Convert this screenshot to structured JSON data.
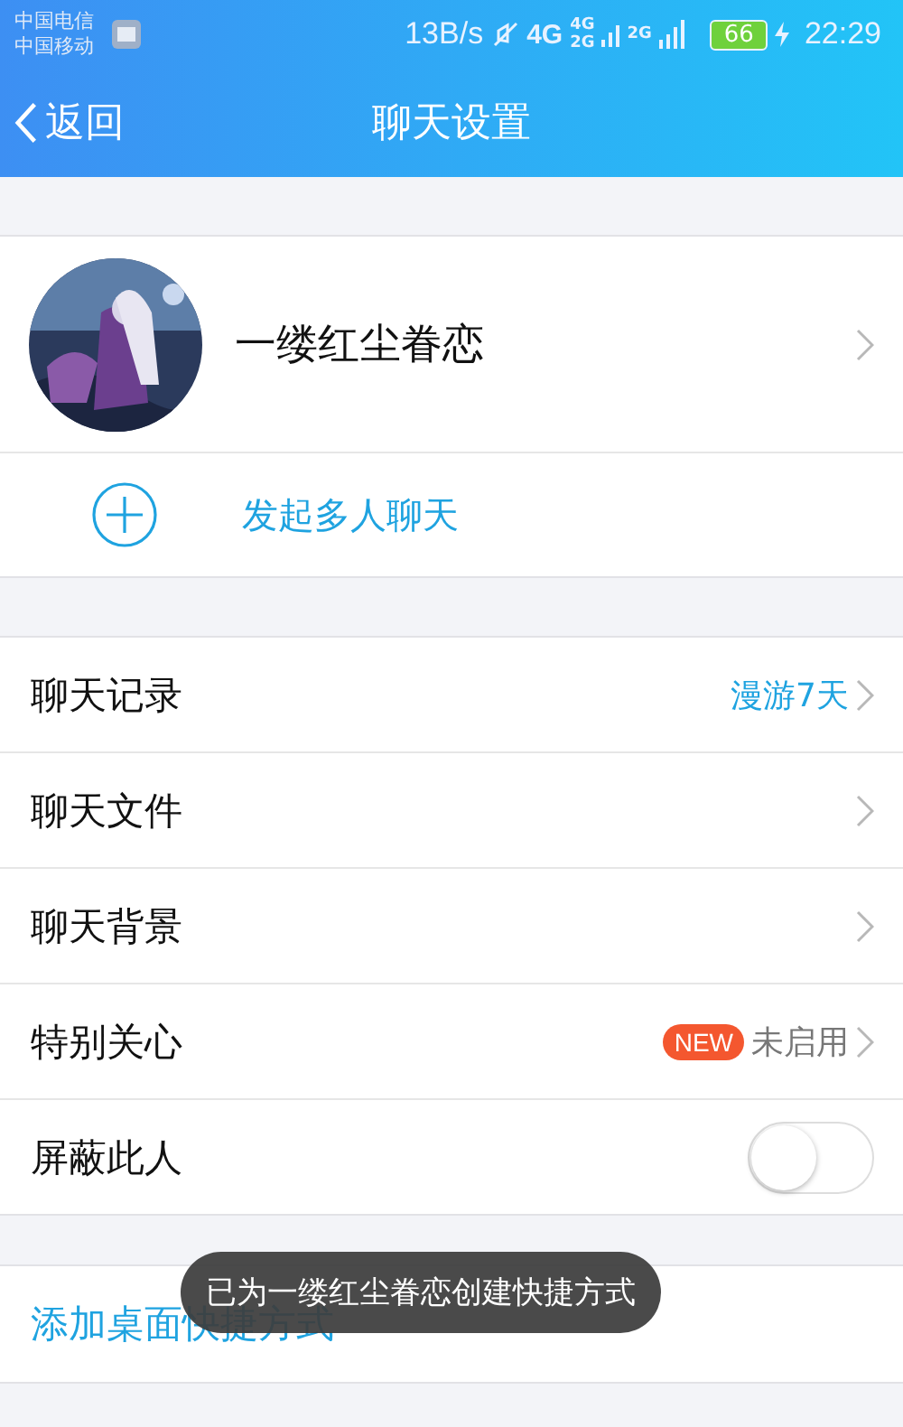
{
  "status_bar": {
    "carriers": [
      "中国电信",
      "中国移动"
    ],
    "speed": "13B/s",
    "network": "4G",
    "sim_labels": [
      "4G",
      "2G",
      "2G"
    ],
    "battery": "66",
    "time": "22:29"
  },
  "header": {
    "back": "返回",
    "title": "聊天设置"
  },
  "profile": {
    "name": "一缕红尘眷恋"
  },
  "group_chat": {
    "label": "发起多人聊天"
  },
  "settings": [
    {
      "kind": "link",
      "label": "聊天记录",
      "value": "漫游7天",
      "color": "#1fa3e0"
    },
    {
      "kind": "link",
      "label": "聊天文件"
    },
    {
      "kind": "link",
      "label": "聊天背景"
    },
    {
      "kind": "link",
      "label": "特别关心",
      "badge": "NEW",
      "value": "未启用",
      "color": "#777777"
    },
    {
      "kind": "toggle",
      "label": "屏蔽此人",
      "on": false
    }
  ],
  "shortcut": {
    "label": "添加桌面快捷方式"
  },
  "toast": "已为一缕红尘眷恋创建快捷方式"
}
